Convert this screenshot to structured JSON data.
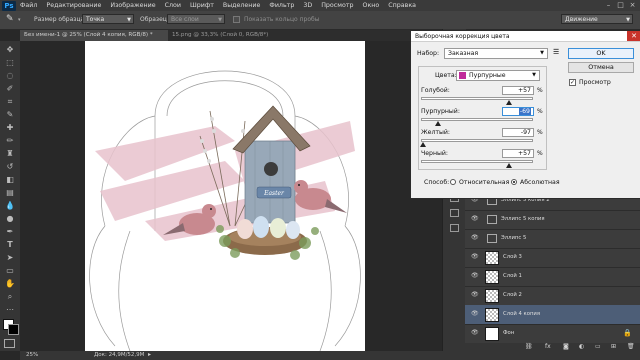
{
  "menubar": {
    "logo": "Ps",
    "items": [
      "Файл",
      "Редактирование",
      "Изображение",
      "Слои",
      "Шрифт",
      "Выделение",
      "Фильтр",
      "3D",
      "Просмотр",
      "Окно",
      "Справка"
    ]
  },
  "options": {
    "sample_size_label": "Размер образца:",
    "sample_size_value": "Точка",
    "sample_label": "Образец:",
    "sample_value": "Все слои",
    "show_ring_label": "Показать кольцо пробы",
    "workspace_value": "Движение"
  },
  "tabs": [
    {
      "label": "Без имени-1 @ 25% (Слой 4 копия, RGB/8) *"
    },
    {
      "label": "15.png @ 33,3% (Слой 0, RGB/8*)"
    }
  ],
  "status": {
    "zoom": "25%",
    "doc": "Док: 24,9M/52,9M"
  },
  "dialog": {
    "title": "Выборочная коррекция цвета",
    "preset_label": "Набор:",
    "preset_value": "Заказная",
    "ok": "OK",
    "cancel": "Отмена",
    "preview_label": "Просмотр",
    "colors_label": "Цвета:",
    "colors_value": "Пурпурные",
    "swatch_color": "#c02a9a",
    "sliders": [
      {
        "label": "Голубой:",
        "value": "+57",
        "unit": "%",
        "level": 0.785
      },
      {
        "label": "Пурпурный:",
        "value": "-69",
        "unit": "%",
        "level": 0.155
      },
      {
        "label": "Желтый:",
        "value": "-97",
        "unit": "%",
        "level": 0.015
      },
      {
        "label": "Черный:",
        "value": "+57",
        "unit": "%",
        "level": 0.785
      }
    ],
    "method_label": "Способ:",
    "method_relative": "Относительная",
    "method_absolute": "Абсолютная"
  },
  "layers": [
    {
      "name": "Эллипс 5 копия 2",
      "kind": "shape"
    },
    {
      "name": "Эллипс 5 копия",
      "kind": "shape"
    },
    {
      "name": "Эллипс 5",
      "kind": "shape"
    },
    {
      "name": "Слой 3",
      "kind": "pixel"
    },
    {
      "name": "Слой 1",
      "kind": "pixel"
    },
    {
      "name": "Слой 2",
      "kind": "pixel"
    },
    {
      "name": "Слой 4 копия",
      "kind": "pixel",
      "selected": true
    },
    {
      "name": "Фон",
      "kind": "bg"
    }
  ],
  "artwork": {
    "sign_text": "Easter"
  }
}
